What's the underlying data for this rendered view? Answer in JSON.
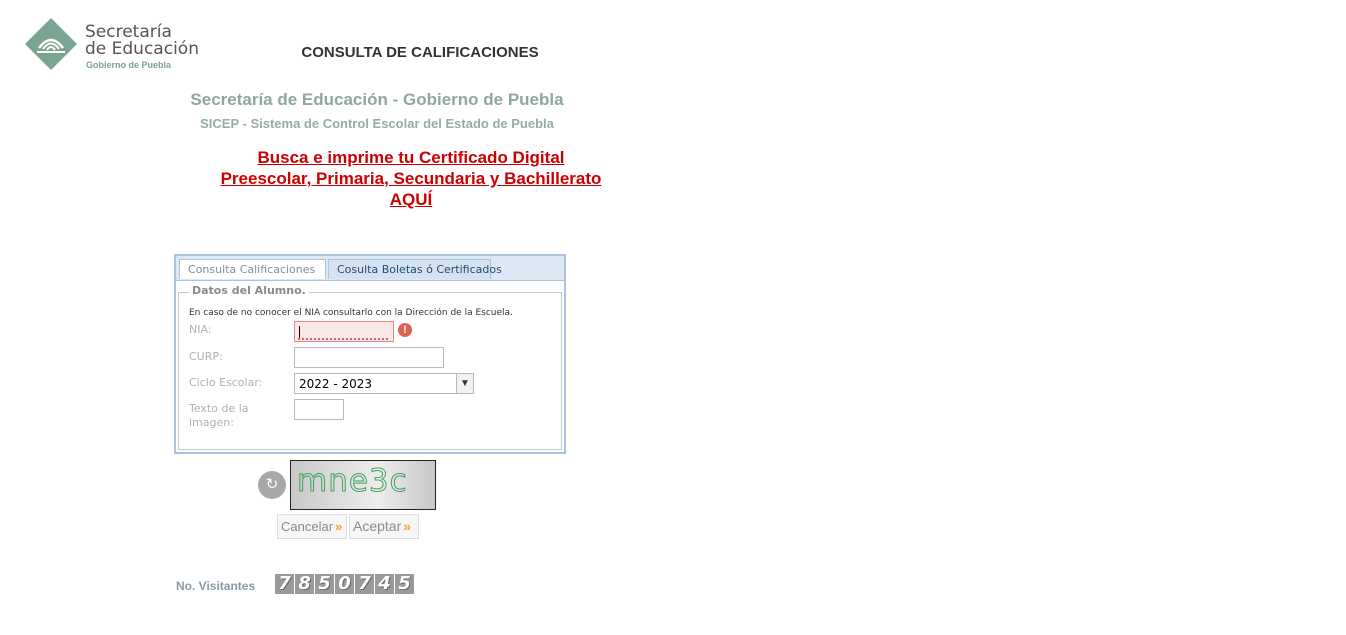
{
  "header": {
    "logo_line1": "Secretaría",
    "logo_line2": "de Educación",
    "logo_line3": "Gobierno de Puebla",
    "page_title": "CONSULTA DE CALIFICACIONES"
  },
  "org": {
    "title": "Secretaría de Educación - Gobierno de Puebla",
    "subtitle": "SICEP - Sistema de Control Escolar del Estado de Puebla"
  },
  "promo": {
    "line1": "Busca e imprime tu Certificado Digital",
    "line2": "Preescolar, Primaria, Secundaria y Bachillerato",
    "line3": "AQUÍ"
  },
  "tabs": [
    {
      "label": "Consulta Calificaciones",
      "active": true
    },
    {
      "label": "Cosulta Boletas ó Certificados",
      "active": false
    }
  ],
  "form": {
    "legend": "Datos del Alumno.",
    "hint": "En caso de no conocer el NIA consultarlo con la Dirección de la Escuela.",
    "nia_label": "NIA:",
    "nia_value": "",
    "curp_label": "CURP:",
    "curp_value": "",
    "ciclo_label": "Ciclo Escolar:",
    "ciclo_value": "2022 - 2023",
    "texto_label": "Texto de la imagen:",
    "texto_value": ""
  },
  "captcha": {
    "text": "mne3c"
  },
  "buttons": {
    "cancel": "Cancelar",
    "accept": "Aceptar",
    "chevron": "»"
  },
  "visitors": {
    "label": "No. Visitantes",
    "digits": [
      "7",
      "8",
      "5",
      "0",
      "7",
      "4",
      "5"
    ]
  },
  "colors": {
    "accent_green": "#7aa391",
    "link_red": "#cc0000",
    "panel_border": "#a9c4de",
    "error_red": "#e0604f"
  },
  "icons": {
    "logo": "education-logo-icon",
    "error": "error-exclamation-icon",
    "refresh": "refresh-icon",
    "select_arrow": "chevron-down-icon"
  }
}
